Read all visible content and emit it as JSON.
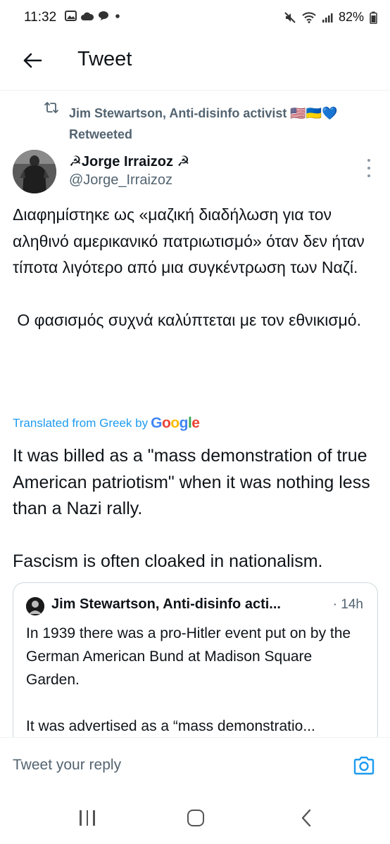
{
  "status_bar": {
    "time": "11:32",
    "battery": "82%"
  },
  "header": {
    "title": "Tweet"
  },
  "retweet": {
    "text": "Jim Stewartson, Anti-disinfo activist 🇺🇸🇺🇦💙",
    "retweeted_label": "Retweeted"
  },
  "author": {
    "name": "☭Jorge Irraizoz ☭",
    "handle": "@Jorge_Irraizoz"
  },
  "tweet": {
    "greek_p1": "Διαφημίστηκε ως «μαζική διαδήλωση για τον αληθινό αμερικανικό πατριωτισμό» όταν δεν ήταν τίποτα λιγότερο από μια συγκέντρωση των Ναζί.",
    "greek_p2": " Ο φασισμός συχνά καλύπτεται με τον εθνικισμό.",
    "translated_label": "Translated from Greek by",
    "translator": "Google",
    "english_p1": "It was billed as a \"mass demonstration of true American patriotism\" when it was nothing less than a Nazi rally.",
    "english_p2": "Fascism is often cloaked in nationalism."
  },
  "quote": {
    "name": "Jim Stewartson, Anti-disinfo acti...",
    "time": "· 14h",
    "p1": "In 1939 there was a pro-Hitler event put on by the German American Bund at Madison Square Garden.",
    "p2": "It was advertised as a “mass demonstratio..."
  },
  "reply": {
    "placeholder": "Tweet your reply"
  },
  "colors": {
    "accent": "#1d9bf0",
    "secondary_text": "#536471",
    "primary_text": "#0f1419"
  }
}
